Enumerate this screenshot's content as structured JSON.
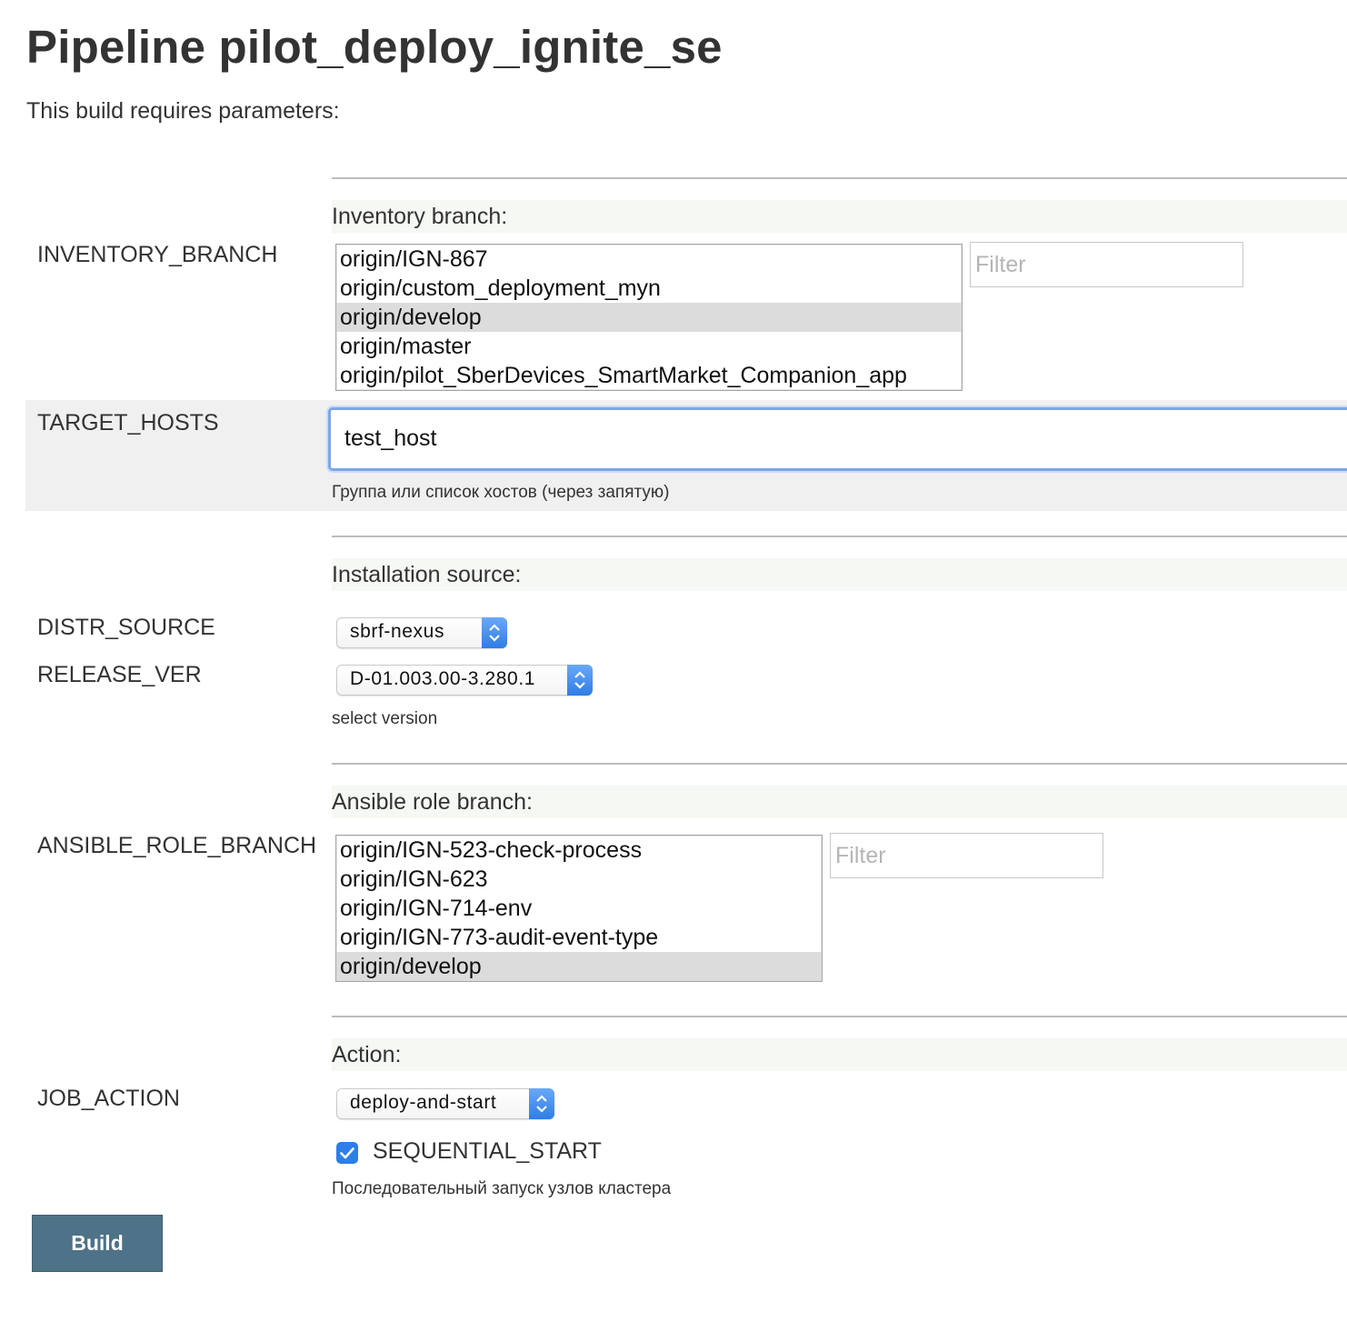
{
  "page_title": "Pipeline pilot_deploy_ignite_se",
  "subtitle": "This build requires parameters:",
  "inventory": {
    "section_title": "Inventory branch:",
    "param_name": "INVENTORY_BRANCH",
    "options": [
      "origin/IGN-867",
      "origin/custom_deployment_myn",
      "origin/develop",
      "origin/master",
      "origin/pilot_SberDevices_SmartMarket_Companion_app"
    ],
    "selected": "origin/develop",
    "filter_placeholder": "Filter"
  },
  "target_hosts": {
    "param_name": "TARGET_HOSTS",
    "value": "test_host",
    "help": "Группа или список хостов (через запятую)"
  },
  "installation": {
    "section_title": "Installation source:",
    "distr_source": {
      "param_name": "DISTR_SOURCE",
      "value": "sbrf-nexus"
    },
    "release_ver": {
      "param_name": "RELEASE_VER",
      "value": "D-01.003.00-3.280.1",
      "help": "select version"
    }
  },
  "ansible": {
    "section_title": "Ansible role branch:",
    "param_name": "ANSIBLE_ROLE_BRANCH",
    "options": [
      "origin/IGN-523-check-process",
      "origin/IGN-623",
      "origin/IGN-714-env",
      "origin/IGN-773-audit-event-type",
      "origin/develop"
    ],
    "selected": "origin/develop",
    "filter_placeholder": "Filter"
  },
  "action": {
    "section_title": "Action:",
    "param_name": "JOB_ACTION",
    "value": "deploy-and-start",
    "sequential": {
      "label": "SEQUENTIAL_START",
      "checked": true,
      "help": "Последовательный запуск узлов кластера"
    }
  },
  "build_button": "Build",
  "colors": {
    "accent": "#2f7de6",
    "build_button": "#4e7287",
    "focus_ring": "#7ea6e8",
    "selected_option": "#dcdcdc"
  }
}
